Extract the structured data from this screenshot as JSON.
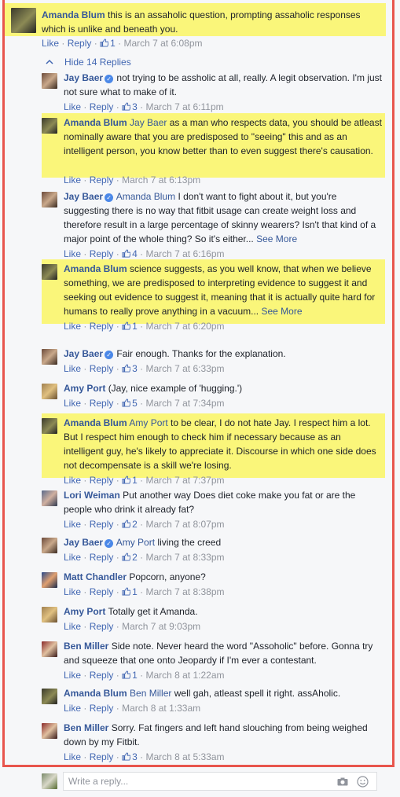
{
  "actions": {
    "like": "Like",
    "reply": "Reply",
    "dot": "·"
  },
  "thread": {
    "top": {
      "author": "Amanda Blum",
      "text": "this is an assaholic question, prompting assaholic responses which is unlike and beneath you.",
      "likes": "1",
      "time": "March 7 at 6:08pm"
    },
    "hide_label": "Hide 14 Replies",
    "replies": [
      {
        "author": "Jay Baer",
        "verified": true,
        "mention": "",
        "text": "not trying to be assholic at all, really. A legit observation. I'm just not sure what to make of it.",
        "likes": "3",
        "time": "March 7 at 6:11pm",
        "see_more": ""
      },
      {
        "author": "Amanda Blum",
        "verified": false,
        "mention": "Jay Baer",
        "text": "as a man who respects data, you should be atleast nominally aware that you are predisposed to \"seeing\" this and as an intelligent person, you know better than to even suggest there's causation.",
        "likes": "",
        "time": "March 7 at 6:13pm",
        "see_more": ""
      },
      {
        "author": "Jay Baer",
        "verified": true,
        "mention": "Amanda Blum",
        "text": "I don't want to fight about it, but you're suggesting there is no way that fitbit usage can create weight loss and therefore result in a large percentage of skinny wearers? Isn't that kind of a major point of the whole thing? So it's either...",
        "likes": "4",
        "time": "March 7 at 6:16pm",
        "see_more": "See More"
      },
      {
        "author": "Amanda Blum",
        "verified": false,
        "mention": "",
        "text": "science suggests, as you well know, that when we believe something, we are predisposed to interpreting evidence to suggest it and seeking out evidence to suggest it, meaning that it is actually quite hard for humans to really prove anything in a vacuum...",
        "likes": "1",
        "time": "March 7 at 6:20pm",
        "see_more": "See More"
      },
      {
        "author": "Jay Baer",
        "verified": true,
        "mention": "",
        "text": "Fair enough. Thanks for the explanation.",
        "likes": "3",
        "time": "March 7 at 6:33pm",
        "see_more": ""
      },
      {
        "author": "Amy Port",
        "verified": false,
        "mention": "",
        "text": "(Jay, nice example of 'hugging.')",
        "likes": "5",
        "time": "March 7 at 7:34pm",
        "see_more": ""
      },
      {
        "author": "Amanda Blum",
        "verified": false,
        "mention": "Amy Port",
        "text": "to be clear, I do not hate Jay. I respect him a lot. But I respect him enough to check him if necessary because as an intelligent guy, he's likely to appreciate it. Discourse in which one side does not decompensate is a skill we're losing.",
        "likes": "1",
        "time": "March 7 at 7:37pm",
        "see_more": ""
      },
      {
        "author": "Lori Weiman",
        "verified": false,
        "mention": "",
        "text": "Put another way Does diet coke make you fat or are the people who drink it already fat?",
        "likes": "2",
        "time": "March 7 at 8:07pm",
        "see_more": ""
      },
      {
        "author": "Jay Baer",
        "verified": true,
        "mention": "Amy Port",
        "text": "living the creed",
        "likes": "2",
        "time": "March 7 at 8:33pm",
        "see_more": ""
      },
      {
        "author": "Matt Chandler",
        "verified": false,
        "mention": "",
        "text": "Popcorn, anyone?",
        "likes": "1",
        "time": "March 7 at 8:38pm",
        "see_more": ""
      },
      {
        "author": "Amy Port",
        "verified": false,
        "mention": "",
        "text": "Totally get it Amanda.",
        "likes": "",
        "time": "March 7 at 9:03pm",
        "see_more": ""
      },
      {
        "author": "Ben Miller",
        "verified": false,
        "mention": "",
        "text": "Side note. Never heard the word \"Assoholic\" before. Gonna try and squeeze that one onto Jeopardy if I'm ever a contestant.",
        "likes": "1",
        "time": "March 8 at 1:22am",
        "see_more": ""
      },
      {
        "author": "Amanda Blum",
        "verified": false,
        "mention": "Ben Miller",
        "text": "well gah, atleast spell it right. assAholic.",
        "likes": "",
        "time": "March 8 at 1:33am",
        "see_more": ""
      },
      {
        "author": "Ben Miller",
        "verified": false,
        "mention": "",
        "text": "Sorry. Fat fingers and left hand slouching from being weighed down by my Fitbit.",
        "likes": "3",
        "time": "March 8 at 5:33am",
        "see_more": ""
      }
    ]
  },
  "composer": {
    "placeholder": "Write a reply..."
  },
  "colors": {
    "highlight": "#faf67a",
    "frame": "#e8554d",
    "link": "#365899"
  }
}
